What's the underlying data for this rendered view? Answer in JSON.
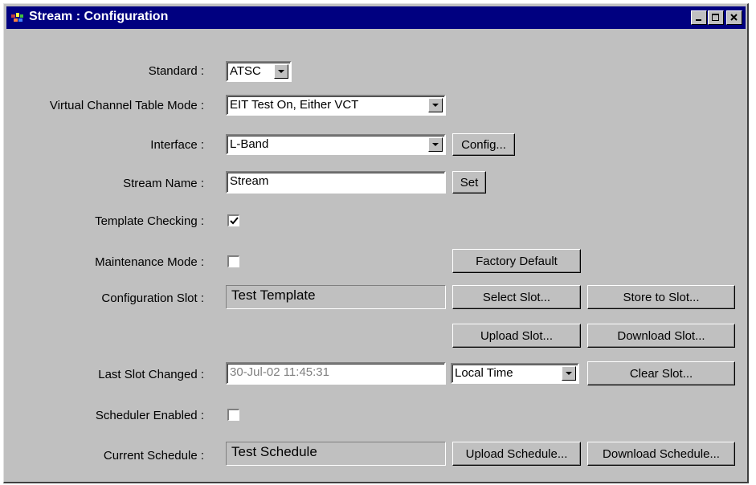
{
  "window": {
    "title": "Stream : Configuration"
  },
  "labels": {
    "standard": "Standard :",
    "vct_mode": "Virtual Channel Table Mode :",
    "interface": "Interface :",
    "stream_name": "Stream Name :",
    "template_checking": "Template Checking :",
    "maintenance_mode": "Maintenance Mode :",
    "configuration_slot": "Configuration Slot :",
    "last_slot_changed": "Last Slot Changed :",
    "scheduler_enabled": "Scheduler Enabled :",
    "current_schedule": "Current Schedule :"
  },
  "fields": {
    "standard": "ATSC",
    "vct_mode": "EIT Test On, Either VCT",
    "interface": "L-Band",
    "stream_name": "Stream",
    "configuration_slot": "Test Template",
    "last_slot_changed": "30-Jul-02 11:45:31",
    "time_zone": "Local Time",
    "current_schedule": "Test Schedule"
  },
  "checkboxes": {
    "template_checking": true,
    "maintenance_mode": false,
    "scheduler_enabled": false
  },
  "buttons": {
    "config": "Config...",
    "set": "Set",
    "factory_default": "Factory Default",
    "select_slot": "Select Slot...",
    "store_to_slot": "Store to Slot...",
    "upload_slot": "Upload Slot...",
    "download_slot": "Download Slot...",
    "clear_slot": "Clear Slot...",
    "upload_schedule": "Upload Schedule...",
    "download_schedule": "Download Schedule..."
  },
  "colors": {
    "titlebar": "#000080",
    "face": "#c0c0c0"
  }
}
